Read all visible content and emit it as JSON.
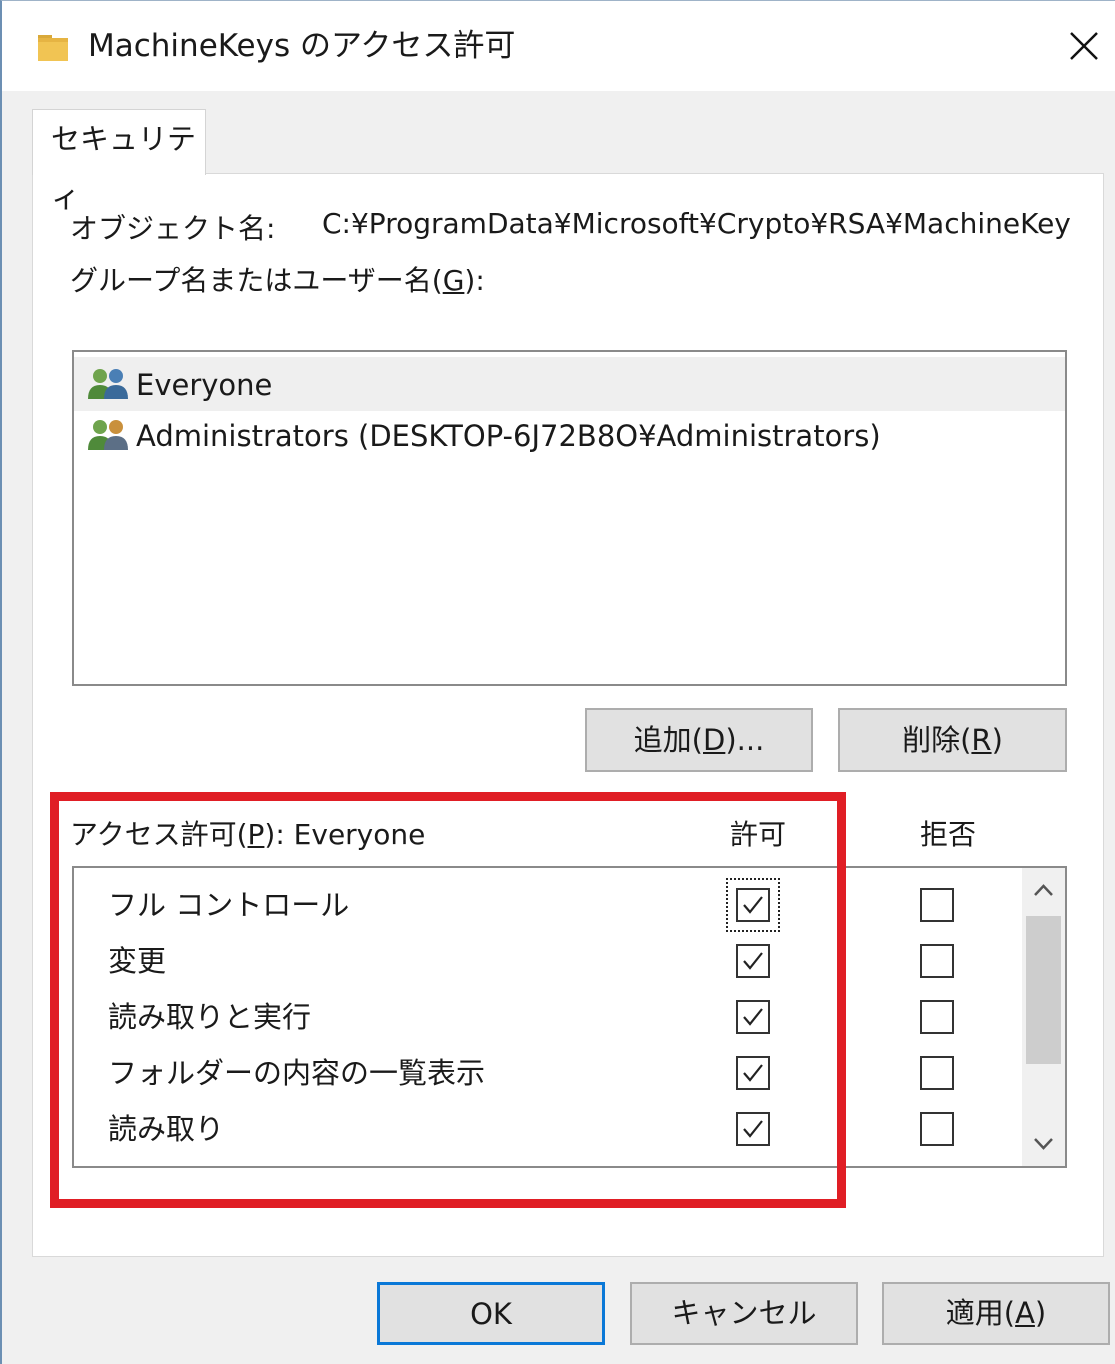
{
  "window": {
    "title": "MachineKeys のアクセス許可",
    "close_glyph": "✕"
  },
  "tabs": [
    {
      "label": "セキュリティ"
    }
  ],
  "object": {
    "label": "オブジェクト名:",
    "path": "C:¥ProgramData¥Microsoft¥Crypto¥RSA¥MachineKeys"
  },
  "groups": {
    "label_prefix": "グループ名またはユーザー名(",
    "label_key": "G",
    "label_suffix": "):",
    "items": [
      {
        "name": "Everyone",
        "selected": true,
        "icon": "users-icon"
      },
      {
        "name": "Administrators (DESKTOP-6J72B8O¥Administrators)",
        "selected": false,
        "icon": "users-icon"
      }
    ]
  },
  "buttons": {
    "add_prefix": "追加(",
    "add_key": "D",
    "add_suffix": ")...",
    "remove_prefix": "削除(",
    "remove_key": "R",
    "remove_suffix": ")",
    "ok": "OK",
    "cancel": "キャンセル",
    "apply_prefix": "適用(",
    "apply_key": "A",
    "apply_suffix": ")"
  },
  "permissions": {
    "label_prefix": "アクセス許可(",
    "label_key": "P",
    "label_suffix": "): Everyone",
    "col_allow": "許可",
    "col_deny": "拒否",
    "rows": [
      {
        "name": "フル コントロール",
        "allow": true,
        "deny": false
      },
      {
        "name": "変更",
        "allow": true,
        "deny": false
      },
      {
        "name": "読み取りと実行",
        "allow": true,
        "deny": false
      },
      {
        "name": "フォルダーの内容の一覧表示",
        "allow": true,
        "deny": false
      },
      {
        "name": "読み取り",
        "allow": true,
        "deny": false
      }
    ]
  },
  "colors": {
    "highlight": "#e01e25",
    "default_button_border": "#0a78d7"
  }
}
